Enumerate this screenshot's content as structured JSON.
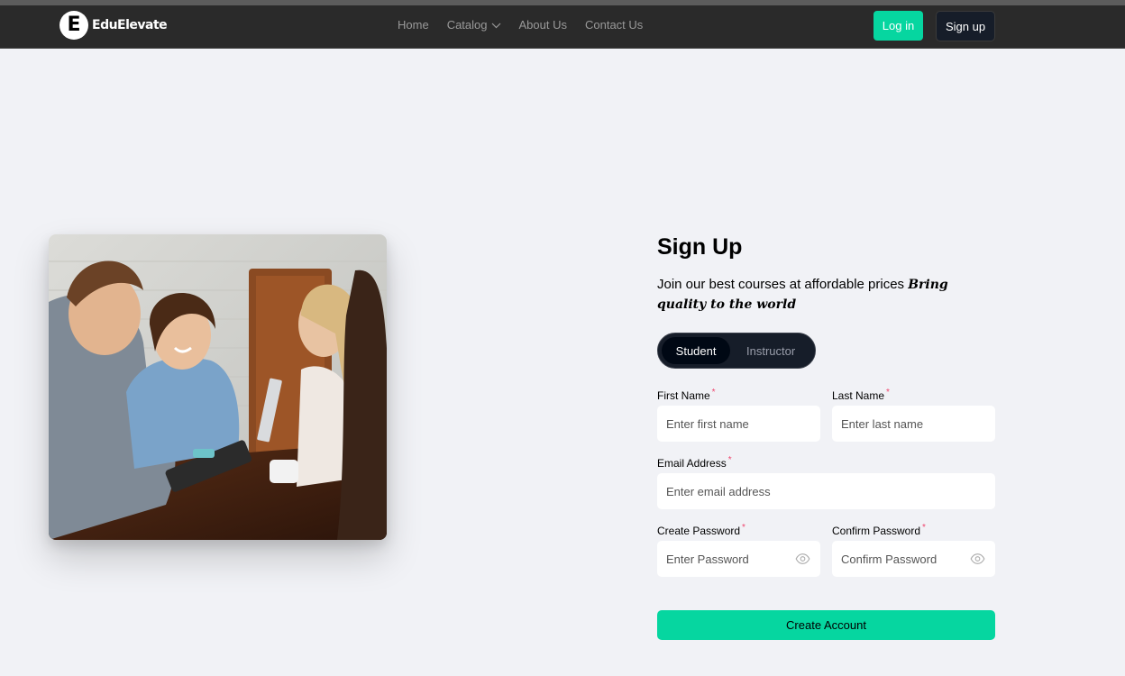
{
  "brand": {
    "logo_letter": "E",
    "name": "EduElevate"
  },
  "nav": {
    "links": [
      "Home",
      "Catalog",
      "About Us",
      "Contact Us"
    ],
    "login_label": "Log in",
    "signup_label": "Sign up"
  },
  "form": {
    "title": "Sign Up",
    "subtitle": "Join our best courses at affordable prices",
    "subtitle_highlight": "Bring quality to the world",
    "roles": [
      "Student",
      "Instructor"
    ],
    "selected_role": "Student",
    "first_name": {
      "label": "First Name",
      "placeholder": "Enter first name",
      "value": ""
    },
    "last_name": {
      "label": "Last Name",
      "placeholder": "Enter last name",
      "value": ""
    },
    "email": {
      "label": "Email Address",
      "placeholder": "Enter email address",
      "value": ""
    },
    "password": {
      "label": "Create Password",
      "placeholder": "Enter Password",
      "value": ""
    },
    "confirm_password": {
      "label": "Confirm Password",
      "placeholder": "Confirm Password",
      "value": ""
    },
    "required_marker": "*",
    "submit_label": "Create Account"
  },
  "colors": {
    "accent": "#06d6a0",
    "dark": "#161d29",
    "navbar": "#2a2a2a",
    "required": "#ef476f",
    "background": "#f1f2f6"
  }
}
